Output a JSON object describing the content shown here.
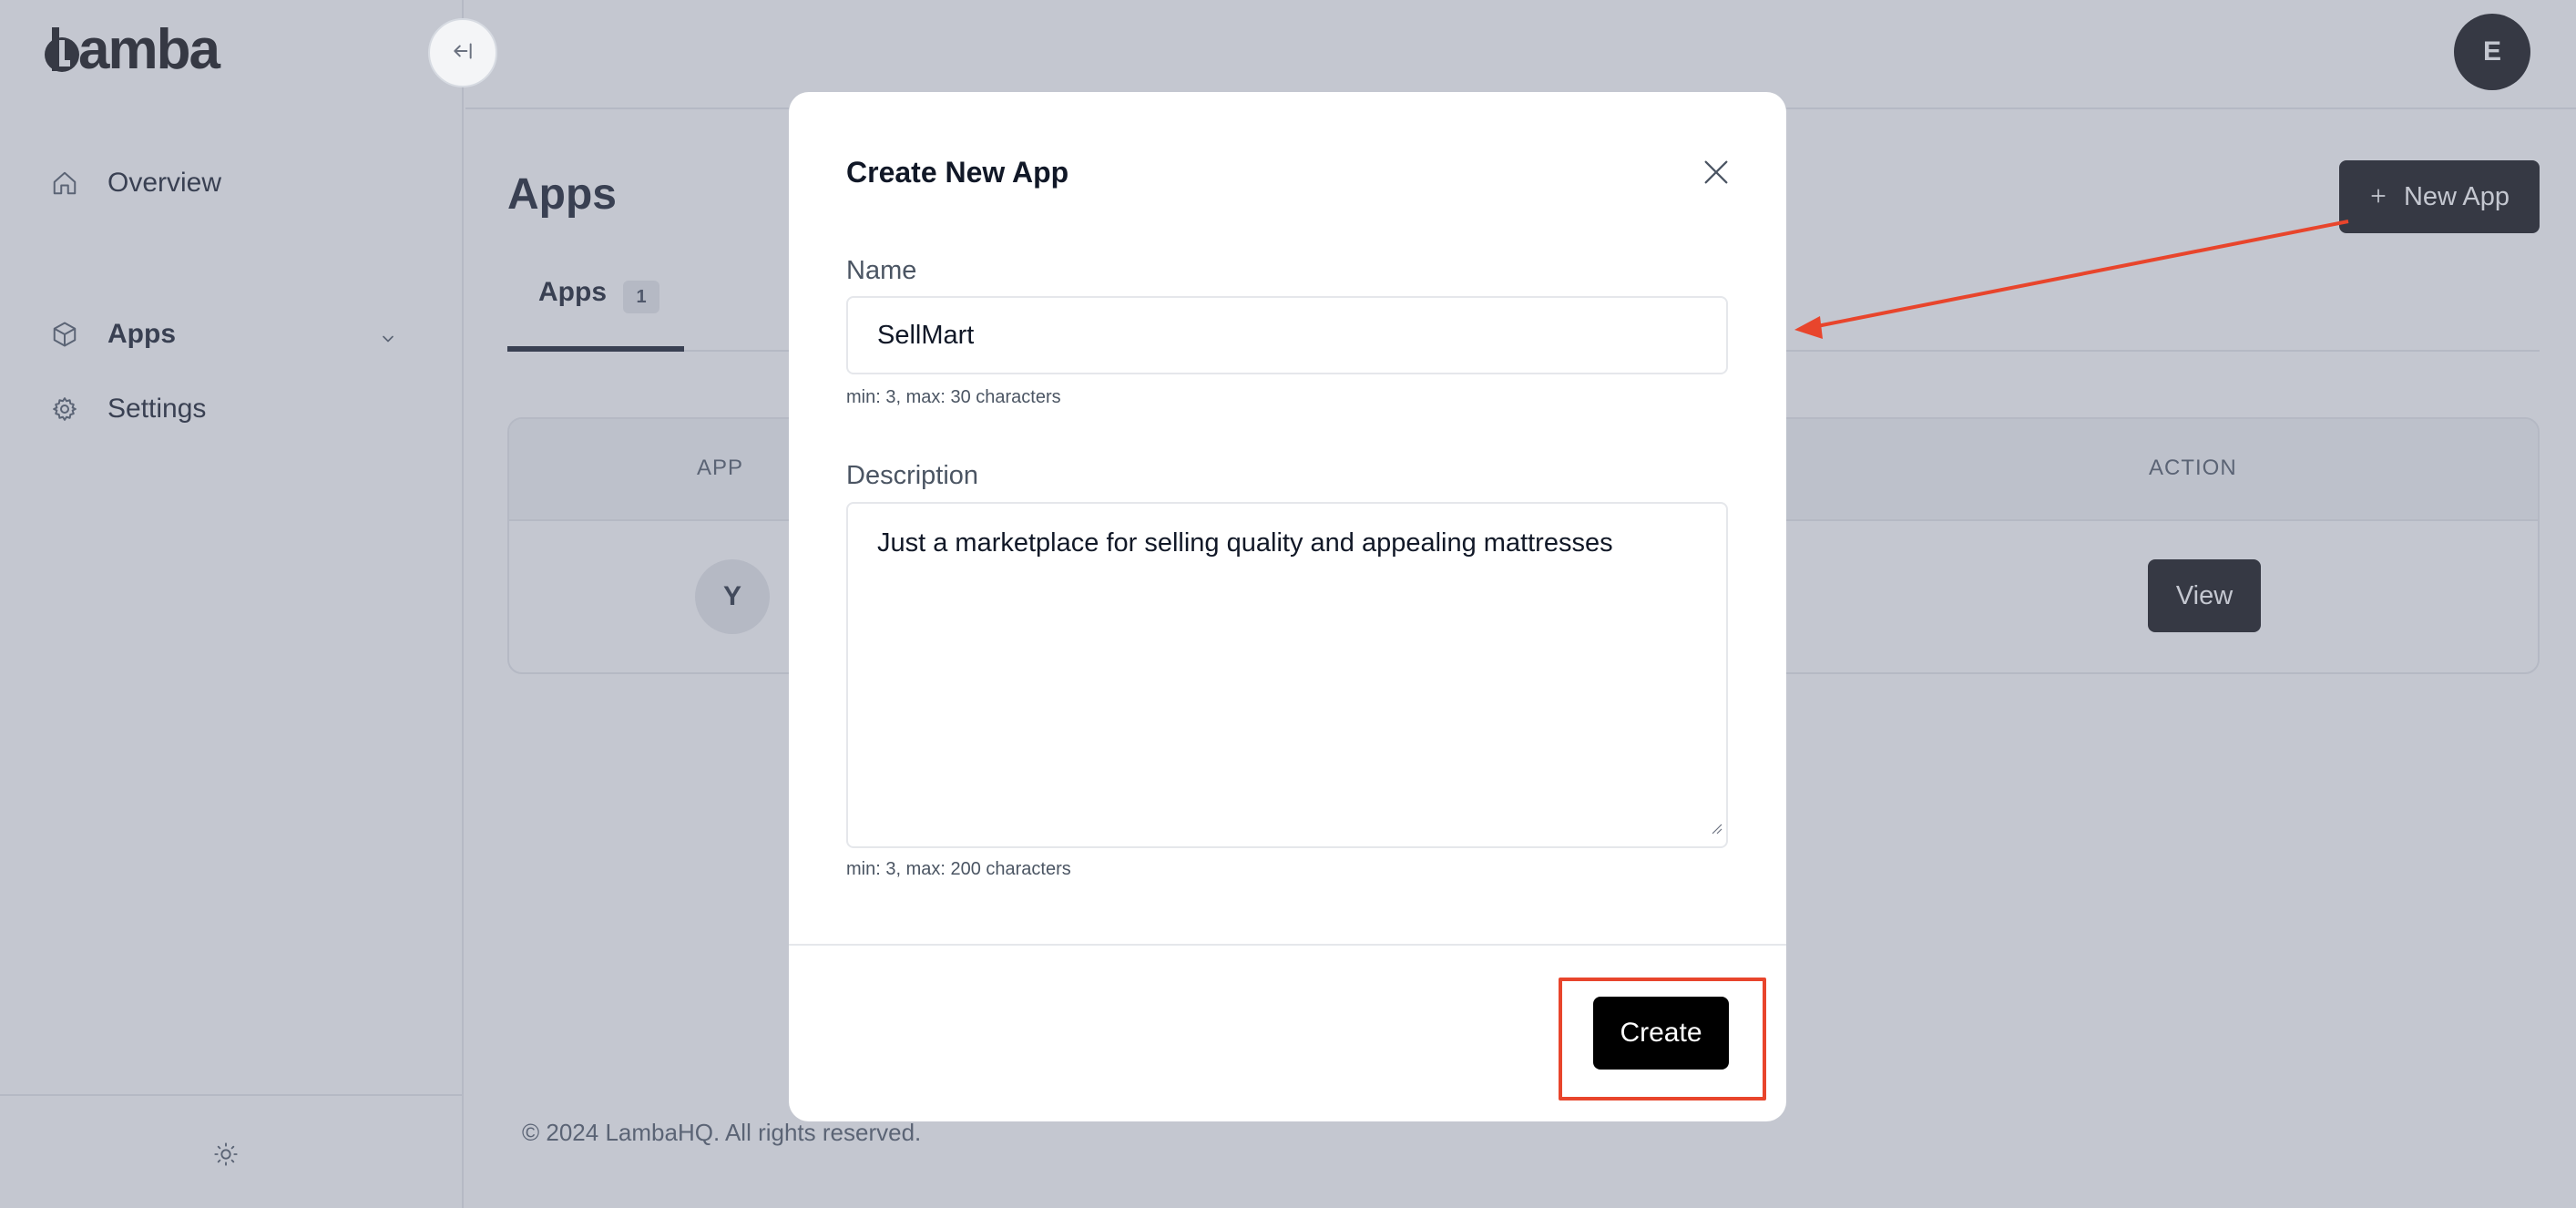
{
  "brand": {
    "logo_text": "amba",
    "logo_aria": "Lamba"
  },
  "sidebar": {
    "items": [
      {
        "label": "Overview",
        "icon": "home-icon"
      },
      {
        "label": "Apps",
        "icon": "cube-icon",
        "active": true
      },
      {
        "label": "Settings",
        "icon": "gear-icon"
      }
    ],
    "footer_icon": "sun-icon"
  },
  "header": {
    "avatar_initial": "E"
  },
  "main": {
    "title": "Apps",
    "new_app_label": "New App",
    "tabs": [
      {
        "label": "Apps",
        "count": "1"
      }
    ],
    "table": {
      "columns": [
        "APP",
        "ACTION"
      ],
      "rows": [
        {
          "avatar_initial": "Y",
          "action_label": "View"
        }
      ]
    },
    "footer": "© 2024 LambaHQ. All rights reserved."
  },
  "modal": {
    "title": "Create New App",
    "name_label": "Name",
    "name_value": "SellMart",
    "name_hint": "min: 3, max: 30 characters",
    "description_label": "Description",
    "description_value": "Just a marketplace for selling quality and appealing mattresses",
    "description_hint": "min: 3, max: 200 characters",
    "submit_label": "Create"
  },
  "annotation": {
    "color": "#e8452c"
  },
  "colors": {
    "primary": "#0b0b0f",
    "overlay": "#737a8e",
    "border": "#e5e7eb",
    "annotation": "#e8452c"
  }
}
